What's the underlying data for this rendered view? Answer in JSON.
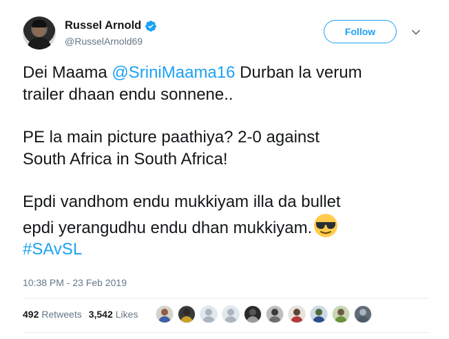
{
  "author": {
    "name": "Russel Arnold",
    "handle": "@RusselArnold69",
    "verified": true
  },
  "follow_button": {
    "label": "Follow"
  },
  "tweet": {
    "line1_prefix": "Dei Maama ",
    "mention": "@SriniMaama16",
    "line1_suffix": " Durban la verum",
    "line2": "trailer dhaan endu sonnene..",
    "para2_line1": "PE la main picture paathiya? 2-0 against",
    "para2_line2": "South Africa in South Africa!",
    "para3_line1": "Epdi vandhom endu mukkiyam illa da bullet",
    "para3_line2": "epdi yerangudhu endu dhan mukkiyam.",
    "emoji": "smiling-face-with-sunglasses",
    "hashtag": "#SAvSL"
  },
  "timestamp": "10:38 PM - 23 Feb 2019",
  "stats": {
    "retweets_count": "492",
    "retweets_label": "Retweets",
    "likes_count": "3,542",
    "likes_label": "Likes"
  },
  "colors": {
    "accent": "#1da1f2",
    "text": "#14171a",
    "muted": "#657786"
  },
  "likers": [
    {
      "head": "#8b5e45",
      "body": "#3d5fa6",
      "bg": "#d7d2c9"
    },
    {
      "head": "#2f2a26",
      "body": "#c9a227",
      "bg": "#3a3a3a"
    },
    {
      "head": "#a9b4bf",
      "body": "#a9b4bf",
      "bg": "#e1e8ed"
    },
    {
      "head": "#a9b4bf",
      "body": "#a9b4bf",
      "bg": "#e1e8ed"
    },
    {
      "head": "#555555",
      "body": "#999999",
      "bg": "#2a2a2a"
    },
    {
      "head": "#3b3b3b",
      "body": "#6e6e6e",
      "bg": "#bdbdbd"
    },
    {
      "head": "#5a4636",
      "body": "#b23a3a",
      "bg": "#e8e2d8"
    },
    {
      "head": "#4b6b3a",
      "body": "#2e4d8c",
      "bg": "#cdd9e5"
    },
    {
      "head": "#6b5a4a",
      "body": "#6b8f3a",
      "bg": "#c9d7b0"
    },
    {
      "head": "#a9b4bf",
      "body": "#4e5a66",
      "bg": "#5f6b77"
    }
  ]
}
